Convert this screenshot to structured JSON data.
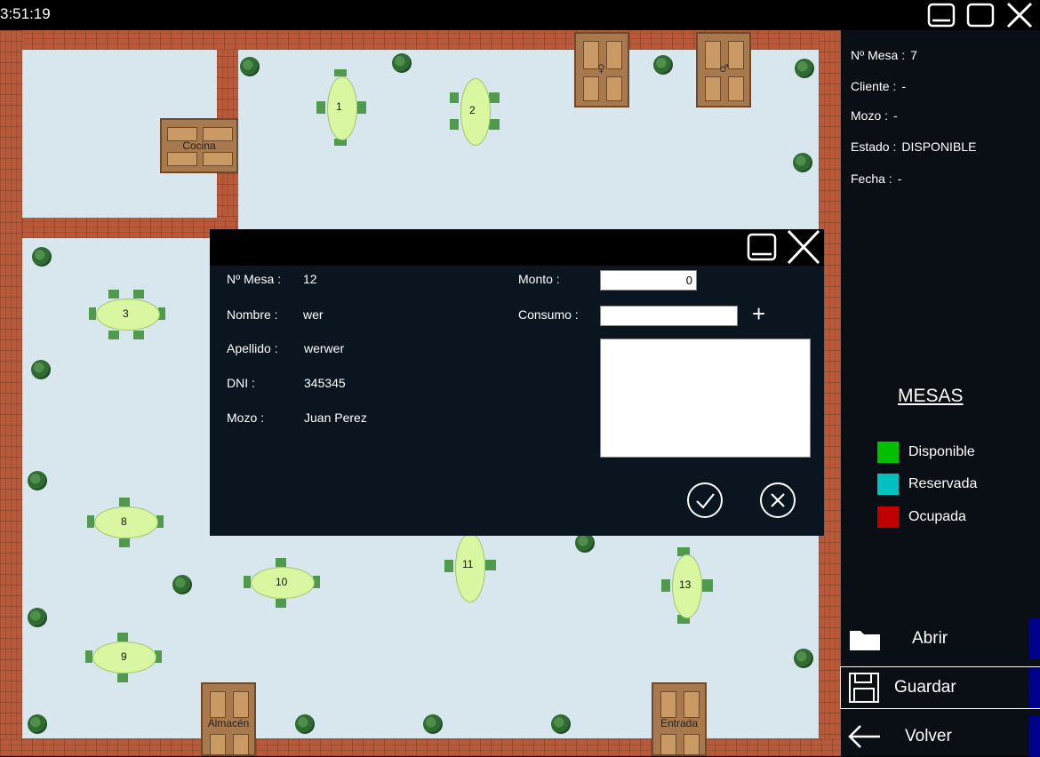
{
  "titlebar": {
    "clock": "3:51:19"
  },
  "floor": {
    "doors": {
      "kitchen": "Cocina",
      "storage": "Almacén",
      "entrance": "Entrada",
      "womens_symbol": "♀",
      "mens_symbol": "♂"
    },
    "tables": [
      "1",
      "2",
      "3",
      "8",
      "9",
      "10",
      "11",
      "13"
    ]
  },
  "sidebar": {
    "info": [
      {
        "label": "Nº Mesa :",
        "value": "7"
      },
      {
        "label": "Cliente :",
        "value": "-"
      },
      {
        "label": "Mozo :",
        "value": "-"
      },
      {
        "label": "Estado :",
        "value": "DISPONIBLE"
      },
      {
        "label": "Fecha :",
        "value": "-"
      }
    ],
    "legend_title": "MESAS",
    "legend": [
      {
        "label": "Disponible",
        "color": "#00c000"
      },
      {
        "label": "Reservada",
        "color": "#00c0c0"
      },
      {
        "label": "Ocupada",
        "color": "#c00000"
      }
    ],
    "buttons": {
      "open": "Abrir",
      "save": "Guardar",
      "back": "Volver"
    }
  },
  "dialog": {
    "fields": [
      {
        "label": "Nº Mesa :",
        "value": "12"
      },
      {
        "label": "Nombre :",
        "value": "wer"
      },
      {
        "label": "Apellido :",
        "value": "werwer"
      },
      {
        "label": "DNI :",
        "value": "345345"
      },
      {
        "label": "Mozo :",
        "value": "Juan Perez"
      }
    ],
    "monto_label": "Monto :",
    "monto_value": "0",
    "consumo_label": "Consumo :",
    "consumo_value": "",
    "add_symbol": "+"
  },
  "colors": {
    "accent_blue": "#00008b",
    "floor": "#d8e6ee",
    "sidebar_bg": "#0a0f16"
  }
}
